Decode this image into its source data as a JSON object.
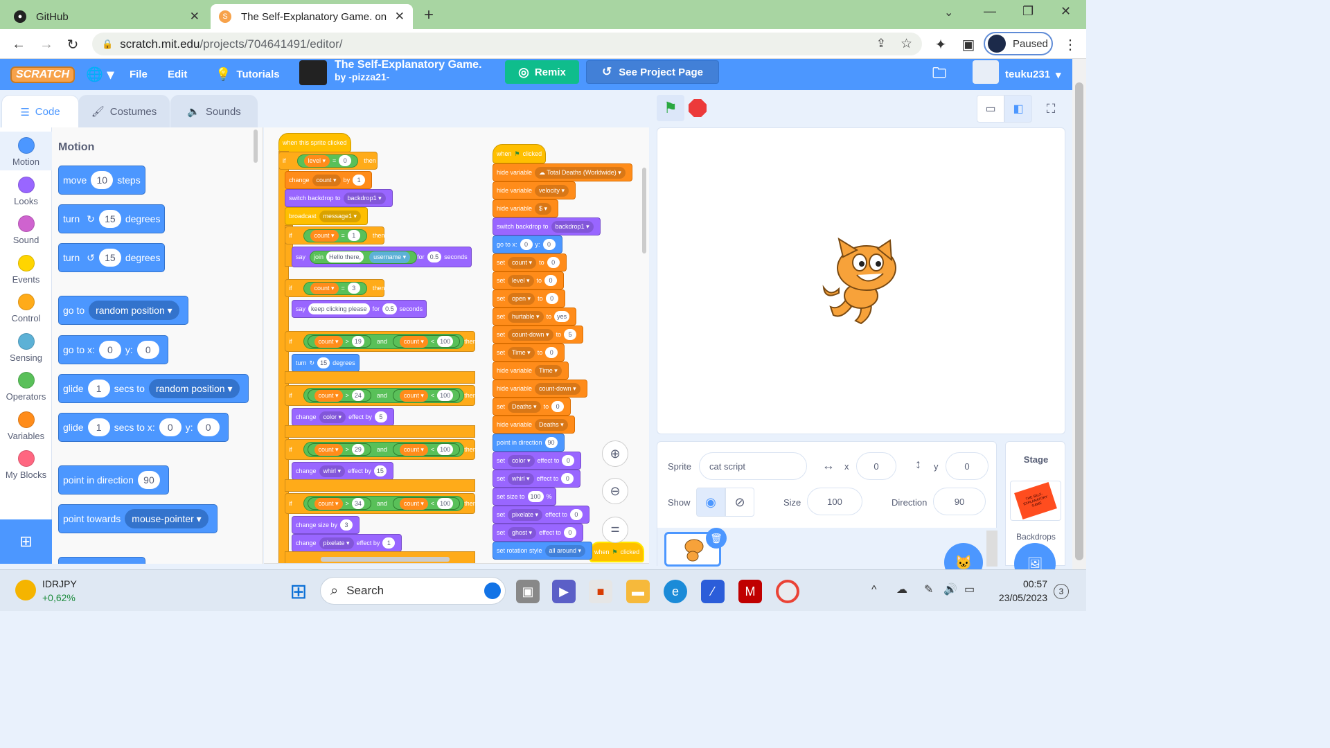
{
  "browser": {
    "tabs": [
      {
        "title": "GitHub"
      },
      {
        "title": "The Self-Explanatory Game. on Sc"
      }
    ],
    "url_host": "scratch.mit.edu",
    "url_path": "/projects/704641491/editor/",
    "profile_status": "Paused"
  },
  "menu": {
    "logo": "SCRATCH",
    "file": "File",
    "edit": "Edit",
    "tutorials": "Tutorials",
    "project_title": "The Self-Explanatory Game.",
    "project_author": "by -pizza21-",
    "remix": "Remix",
    "see_project_page": "See Project Page",
    "username": "teuku231"
  },
  "editor_tabs": {
    "code": "Code",
    "costumes": "Costumes",
    "sounds": "Sounds"
  },
  "categories": [
    {
      "label": "Motion",
      "color": "#4c97ff"
    },
    {
      "label": "Looks",
      "color": "#9966ff"
    },
    {
      "label": "Sound",
      "color": "#cf63cf"
    },
    {
      "label": "Events",
      "color": "#ffd500"
    },
    {
      "label": "Control",
      "color": "#ffab19"
    },
    {
      "label": "Sensing",
      "color": "#5cb1d6"
    },
    {
      "label": "Operators",
      "color": "#59c059"
    },
    {
      "label": "Variables",
      "color": "#ff8c1a"
    },
    {
      "label": "My Blocks",
      "color": "#ff6680"
    }
  ],
  "palette": {
    "heading": "Motion",
    "move": {
      "a": "move",
      "n": "10",
      "b": "steps"
    },
    "turn_right": {
      "a": "turn",
      "n": "15",
      "b": "degrees"
    },
    "turn_left": {
      "a": "turn",
      "n": "15",
      "b": "degrees"
    },
    "goto": {
      "a": "go to",
      "dd": "random position"
    },
    "gotoxy": {
      "a": "go to x:",
      "x": "0",
      "yl": "y:",
      "y": "0"
    },
    "glide1": {
      "a": "glide",
      "n": "1",
      "b": "secs to",
      "dd": "random position"
    },
    "glide2": {
      "a": "glide",
      "n": "1",
      "b": "secs to x:",
      "x": "0",
      "yl": "y:",
      "y": "0"
    },
    "point": {
      "a": "point in direction",
      "n": "90"
    },
    "towards": {
      "a": "point towards",
      "dd": "mouse-pointer"
    }
  },
  "script1": {
    "hat": "when this sprite clicked",
    "if1": {
      "a": "if",
      "v": "level",
      "op": "=",
      "n": "0",
      "t": "then"
    },
    "change": {
      "a": "change",
      "v": "count",
      "b": "by",
      "n": "1"
    },
    "switch": {
      "a": "switch backdrop to",
      "dd": "backdrop1"
    },
    "broadcast": {
      "a": "broadcast",
      "dd": "message1"
    },
    "if2": {
      "a": "if",
      "v": "count",
      "op": "=",
      "n": "1",
      "t": "then"
    },
    "say1": {
      "a": "say",
      "j": "join",
      "s1": "Hello there,",
      "s2": "username",
      "f": "for",
      "n": "0.5",
      "b": "seconds"
    },
    "if3": {
      "a": "if",
      "v": "count",
      "op": "=",
      "n": "3",
      "t": "then"
    },
    "say2": {
      "a": "say",
      "s": "keep clicking please",
      "f": "for",
      "n": "0.5",
      "b": "seconds"
    },
    "if4": {
      "a": "if",
      "v1": "count",
      "o1": ">",
      "n1": "19",
      "and": "and",
      "v2": "count",
      "o2": "<",
      "n2": "100",
      "t": "then"
    },
    "turn": {
      "a": "turn",
      "n": "15",
      "b": "degrees"
    },
    "if5": {
      "a": "if",
      "v1": "count",
      "o1": ">",
      "n1": "24",
      "and": "and",
      "v2": "count",
      "o2": "<",
      "n2": "100",
      "t": "then"
    },
    "eff1": {
      "a": "change",
      "dd": "color",
      "b": "effect by",
      "n": "5"
    },
    "if6": {
      "a": "if",
      "v1": "count",
      "o1": ">",
      "n1": "29",
      "and": "and",
      "v2": "count",
      "o2": "<",
      "n2": "100",
      "t": "then"
    },
    "eff2": {
      "a": "change",
      "dd": "whirl",
      "b": "effect by",
      "n": "15"
    },
    "if7": {
      "a": "if",
      "v1": "count",
      "o1": ">",
      "n1": "34",
      "and": "and",
      "v2": "count",
      "o2": "<",
      "n2": "100",
      "t": "then"
    },
    "size": {
      "a": "change size by",
      "n": "3"
    },
    "eff3": {
      "a": "change",
      "dd": "pixelate",
      "b": "effect by",
      "n": "1"
    }
  },
  "script2": [
    {
      "type": "hat",
      "a": "when",
      "b": "clicked"
    },
    {
      "type": "va",
      "a": "hide variable",
      "dd": "☁ Total Deaths (Worldwide)"
    },
    {
      "type": "va",
      "a": "hide variable",
      "dd": "velocity"
    },
    {
      "type": "va",
      "a": "hide variable",
      "dd": "$"
    },
    {
      "type": "lk",
      "a": "switch backdrop to",
      "dd": "backdrop1"
    },
    {
      "type": "mo",
      "a": "go to x:",
      "n": "0",
      "b": "y:",
      "n2": "0"
    },
    {
      "type": "va",
      "a": "set",
      "dd": "count",
      "b": "to",
      "n": "0"
    },
    {
      "type": "va",
      "a": "set",
      "dd": "level",
      "b": "to",
      "n": "0"
    },
    {
      "type": "va",
      "a": "set",
      "dd": "open",
      "b": "to",
      "n": "0"
    },
    {
      "type": "va",
      "a": "set",
      "dd": "hurtable",
      "b": "to",
      "n": "yes"
    },
    {
      "type": "va",
      "a": "set",
      "dd": "count-down",
      "b": "to",
      "n": "5"
    },
    {
      "type": "va",
      "a": "set",
      "dd": "Time",
      "b": "to",
      "n": "0"
    },
    {
      "type": "va",
      "a": "hide variable",
      "dd": "Time"
    },
    {
      "type": "va",
      "a": "hide variable",
      "dd": "count-down"
    },
    {
      "type": "va",
      "a": "set",
      "dd": "Deaths",
      "b": "to",
      "n": "0"
    },
    {
      "type": "va",
      "a": "hide variable",
      "dd": "Deaths"
    },
    {
      "type": "mo",
      "a": "point in direction",
      "n": "90"
    },
    {
      "type": "lk",
      "a": "set",
      "dd": "color",
      "b": "effect to",
      "n": "0"
    },
    {
      "type": "lk",
      "a": "set",
      "dd": "whirl",
      "b": "effect to",
      "n": "0"
    },
    {
      "type": "lk",
      "a": "set size to",
      "n": "100",
      "b": "%"
    },
    {
      "type": "lk",
      "a": "set",
      "dd": "pixelate",
      "b": "effect to",
      "n": "0"
    },
    {
      "type": "lk",
      "a": "set",
      "dd": "ghost",
      "b": "effect to",
      "n": "0"
    },
    {
      "type": "mo",
      "a": "set rotation style",
      "dd": "all around"
    }
  ],
  "script3_hat": {
    "a": "when",
    "b": "clicked"
  },
  "sprite_info": {
    "sprite_label": "Sprite",
    "sprite_name": "cat script",
    "x_label": "x",
    "x": "0",
    "y_label": "y",
    "y": "0",
    "show_label": "Show",
    "size_label": "Size",
    "size": "100",
    "direction_label": "Direction",
    "direction": "90"
  },
  "stage_panel": {
    "title": "Stage",
    "backdrops": "Backdrops",
    "thumb_text": "THE SELF-EXPLANATORY GAME"
  },
  "taskbar": {
    "ticker": "IDRJPY",
    "ticker_change": "+0,62%",
    "search": "Search",
    "time": "00:57",
    "date": "23/05/2023",
    "badge": "3"
  }
}
